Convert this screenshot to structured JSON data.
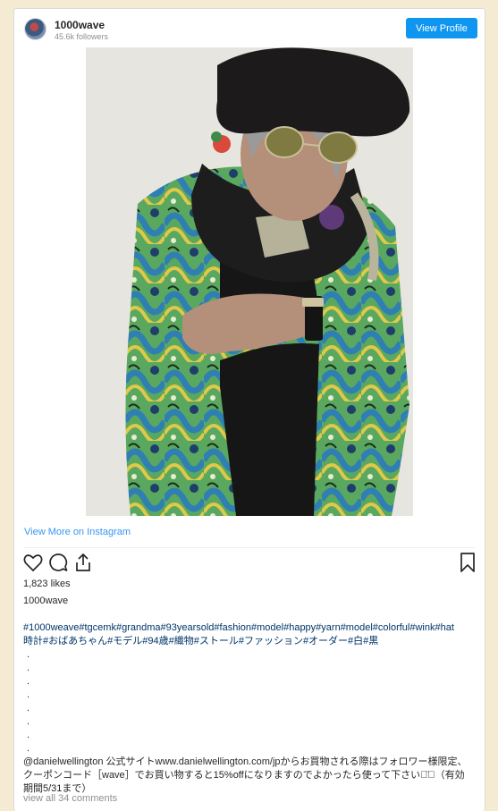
{
  "header": {
    "username": "1000wave",
    "followers": "45.6k followers",
    "view_profile_label": "View Profile"
  },
  "photo": {
    "icon": "photo-grandma-fashion",
    "colors": {
      "background": "#e7e5df",
      "hat": "#1c1a1a",
      "jacket_green": "#5aa860",
      "jacket_blue": "#2f7fb3",
      "jacket_yellow": "#e0c84a"
    }
  },
  "view_more_label": "View More on Instagram",
  "actions": {
    "like_icon": "heart-icon",
    "comment_icon": "comment-icon",
    "share_icon": "share-icon",
    "save_icon": "bookmark-icon"
  },
  "likes": "1,823 likes",
  "caption": {
    "username": "1000wave",
    "hashtags_line1": "#1000weave#tgcemk#grandma#93yearsold#fashion#model#happy#yarn#model#colorful#wink#hat",
    "hashtags_line2": "時計#おばあちゃん#モデル#94歳#織物#ストール#ファッション#オーダー#白#黒",
    "dots": [
      ".",
      ".",
      ".",
      ".",
      ".",
      ".",
      ".",
      "."
    ],
    "promo_text": "@danielwellington 公式サイトwww.danielwellington.com/jpからお買物される際はフォロワー様限定、クーポンコード［wave］でお買い物すると15%offになりますのでよかったら使って下さい◡̈⃝（有効期間5/31まで）"
  },
  "view_comments_label": "view all 34 comments",
  "colors": {
    "accent": "#0f96f0",
    "link": "#3897f0",
    "page_background": "#f5ebd3"
  }
}
